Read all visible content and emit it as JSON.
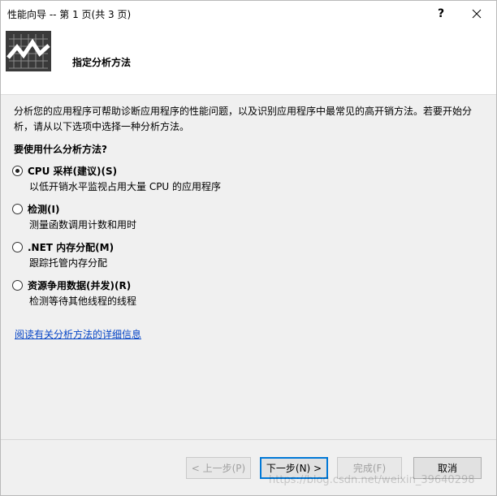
{
  "window": {
    "title": "性能向导 -- 第 1 页(共 3 页)",
    "help_label": "?",
    "close_label": "✕"
  },
  "header": {
    "logo_icon": "performance-chart-icon",
    "title": "指定分析方法"
  },
  "content": {
    "description": "分析您的应用程序可帮助诊断应用程序的性能问题，以及识别应用程序中最常见的高开销方法。若要开始分析，请从以下选项中选择一种分析方法。",
    "question": "要使用什么分析方法?",
    "options": [
      {
        "label": "CPU 采样(建议)(S)",
        "sub": "以低开销水平监视占用大量 CPU 的应用程序",
        "checked": true
      },
      {
        "label": "检测(I)",
        "sub": "测量函数调用计数和用时",
        "checked": false
      },
      {
        "label": ".NET 内存分配(M)",
        "sub": "跟踪托管内存分配",
        "checked": false
      },
      {
        "label": "资源争用数据(并发)(R)",
        "sub": "检测等待其他线程的线程",
        "checked": false
      }
    ],
    "link": "阅读有关分析方法的详细信息"
  },
  "buttons": {
    "prev": "< 上一步(P)",
    "next": "下一步(N) >",
    "finish": "完成(F)",
    "cancel": "取消"
  },
  "watermark": "https://blog.csdn.net/weixin_39640298"
}
